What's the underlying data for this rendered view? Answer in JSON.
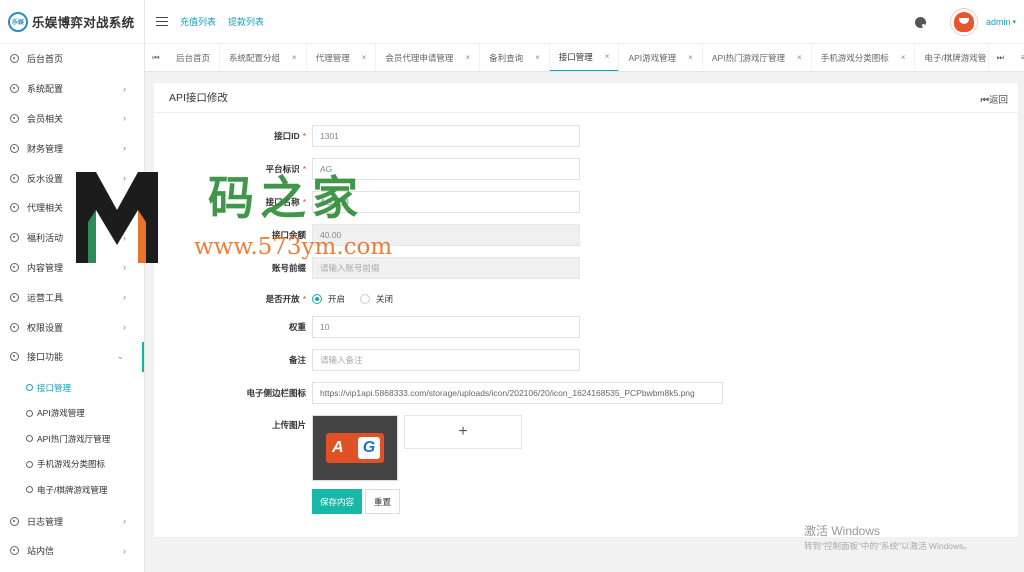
{
  "app": {
    "logo_badge": "乐娱",
    "title": "乐娱博弈对战系统"
  },
  "sidebar": {
    "items": [
      {
        "label": "后台首页",
        "chevron": ""
      },
      {
        "label": "系统配置",
        "chevron": "›"
      },
      {
        "label": "会员相关",
        "chevron": "›"
      },
      {
        "label": "财务管理",
        "chevron": "›"
      },
      {
        "label": "反水设置",
        "chevron": "›"
      },
      {
        "label": "代理相关",
        "chevron": "›"
      },
      {
        "label": "福利活动",
        "chevron": "›"
      },
      {
        "label": "内容管理",
        "chevron": "›"
      },
      {
        "label": "运营工具",
        "chevron": "›"
      },
      {
        "label": "权限设置",
        "chevron": "›"
      },
      {
        "label": "接口功能",
        "chevron": "⌄"
      }
    ],
    "subitems": [
      {
        "label": "接口管理"
      },
      {
        "label": "API游戏管理"
      },
      {
        "label": "API热门游戏厅管理"
      },
      {
        "label": "手机游戏分类图标"
      },
      {
        "label": "电子/棋牌游戏管理"
      }
    ],
    "bottom_items": [
      {
        "label": "日志管理",
        "chevron": "›"
      },
      {
        "label": "站内信",
        "chevron": "›"
      }
    ]
  },
  "header": {
    "links": [
      "充值列表",
      "提款列表"
    ],
    "admin_name": "admin",
    "admin_caret": "▾"
  },
  "tabs": {
    "prev": "⏮",
    "next": "⏭",
    "menu": "≡ ▾",
    "close": "×",
    "items": [
      {
        "label": "后台首页"
      },
      {
        "label": "系统配置分组"
      },
      {
        "label": "代理管理"
      },
      {
        "label": "会员代理申请管理"
      },
      {
        "label": "备利查询"
      },
      {
        "label": "接口管理"
      },
      {
        "label": "API游戏管理"
      },
      {
        "label": "API热门游戏厅管理"
      },
      {
        "label": "手机游戏分类图标"
      },
      {
        "label": "电子/棋牌游戏管"
      }
    ]
  },
  "form": {
    "title": "API接口修改",
    "back_label": "⏮返回",
    "required_mark": "*",
    "fields": {
      "id": {
        "label": "接口ID",
        "value": "1301"
      },
      "platform": {
        "label": "平台标识",
        "value": "AG"
      },
      "name": {
        "label": "接口名称",
        "value": "AG亚游"
      },
      "balance": {
        "label": "接口余额",
        "value": "40.00"
      },
      "prefix": {
        "label": "账号前缀",
        "placeholder": "请输入账号前缀"
      },
      "open": {
        "label": "是否开放",
        "option_on": "开启",
        "option_off": "关闭"
      },
      "weight": {
        "label": "权重",
        "value": "10"
      },
      "remark": {
        "label": "备注",
        "placeholder": "请输入备注"
      },
      "sidebar_icon": {
        "label": "电子侧边栏图标",
        "value": "https://vip1api.5868333.com/storage/uploads/icon/202106/20/icon_1624168535_PCPbwbm8k5.png"
      },
      "upload": {
        "label": "上传图片",
        "plus": "+",
        "thumb_a": "A",
        "thumb_g": "G"
      }
    },
    "save_label": "保存内容",
    "reset_label": "重置"
  },
  "watermark": {
    "title": "码之家",
    "url": "www.573ym.com"
  },
  "windows": {
    "activate_title": "激活 Windows",
    "activate_sub": "转到\"控制面板\"中的\"系统\"以激活 Windows。"
  },
  "colors": {
    "accent": "#17a2b8",
    "primary_button": "#17b8a8",
    "required": "#e64a19"
  }
}
